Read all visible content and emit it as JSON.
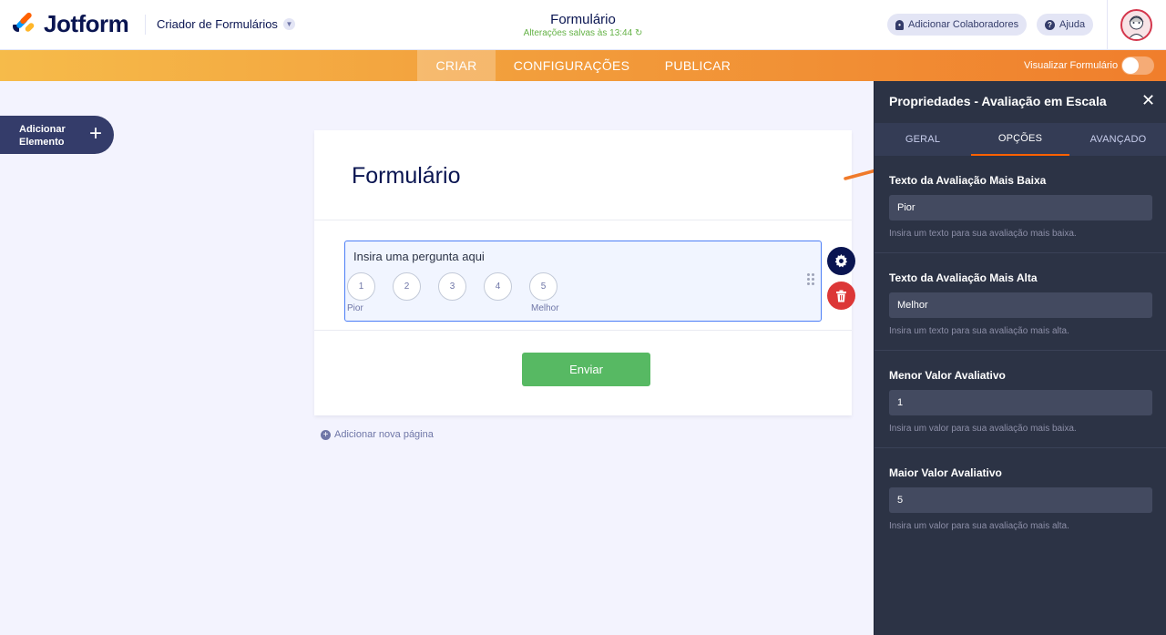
{
  "header": {
    "logo_text": "Jotform",
    "builder_label": "Criador de Formulários",
    "form_title": "Formulário",
    "saved_status": "Alterações salvas às 13:44",
    "collaborators_label": "Adicionar Colaboradores",
    "help_label": "Ajuda"
  },
  "nav": {
    "tabs": [
      {
        "label": "CRIAR",
        "active": true
      },
      {
        "label": "CONFIGURAÇÕES",
        "active": false
      },
      {
        "label": "PUBLICAR",
        "active": false
      }
    ],
    "preview_label": "Visualizar Formulário",
    "preview_enabled": false
  },
  "sidebar": {
    "add_element_label": "Adicionar Elemento"
  },
  "form": {
    "title": "Formulário",
    "question_label": "Insira uma pergunta aqui",
    "scale": [
      "1",
      "2",
      "3",
      "4",
      "5"
    ],
    "low_caption": "Pior",
    "high_caption": "Melhor",
    "submit_label": "Enviar",
    "add_page_label": "Adicionar nova página"
  },
  "panel": {
    "title": "Propriedades - Avaliação em Escala",
    "tabs": [
      {
        "label": "GERAL",
        "active": false
      },
      {
        "label": "OPÇÕES",
        "active": true
      },
      {
        "label": "AVANÇADO",
        "active": false
      }
    ],
    "fields": [
      {
        "label": "Texto da Avaliação Mais Baixa",
        "value": "Pior",
        "help": "Insira um texto para sua avaliação mais baixa."
      },
      {
        "label": "Texto da Avaliação Mais Alta",
        "value": "Melhor",
        "help": "Insira um texto para sua avaliação mais alta."
      },
      {
        "label": "Menor Valor Avaliativo",
        "value": "1",
        "help": "Insira um valor para sua avaliação mais baixa."
      },
      {
        "label": "Maior Valor Avaliativo",
        "value": "5",
        "help": "Insira um valor para sua avaliação mais alta."
      }
    ]
  },
  "colors": {
    "accent": "#ff6100",
    "navy": "#0a1551",
    "panel_bg": "#2c3345",
    "submit_green": "#57b963",
    "delete_red": "#dc3737"
  }
}
